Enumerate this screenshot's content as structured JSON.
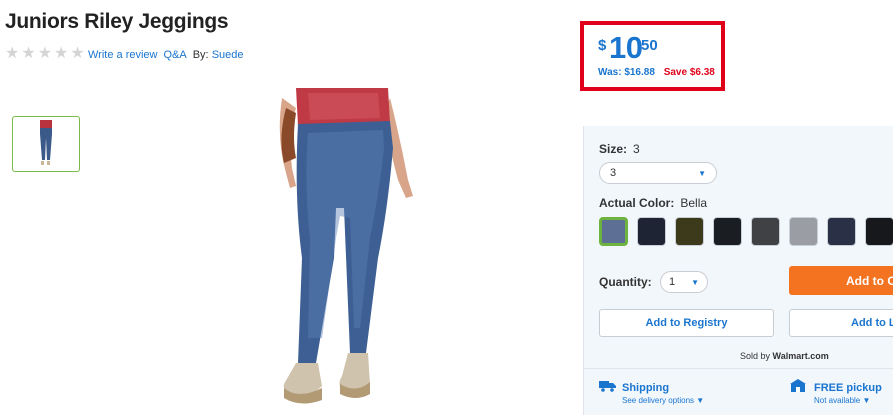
{
  "product": {
    "title": "Juniors Riley Jeggings",
    "rating_stars": 0,
    "write_review": "Write a review",
    "qa": "Q&A",
    "by_label": "By:",
    "brand": "Suede"
  },
  "price": {
    "dollar_sign": "$",
    "main": "10",
    "cents": "50",
    "was_label": "Was:",
    "was_price": "$16.88",
    "save": "Save $6.38"
  },
  "options": {
    "size_label": "Size:",
    "size_value": "3",
    "size_selected": "3",
    "color_label": "Actual Color:",
    "color_value": "Bella",
    "swatches": [
      {
        "name": "Bella",
        "color": "#5e6f96",
        "selected": true
      },
      {
        "name": "swatch-2",
        "color": "#1f2435",
        "selected": false
      },
      {
        "name": "swatch-3",
        "color": "#3d3a1c",
        "selected": false
      },
      {
        "name": "swatch-4",
        "color": "#1a1d22",
        "selected": false
      },
      {
        "name": "swatch-5",
        "color": "#3f4144",
        "selected": false
      },
      {
        "name": "swatch-6",
        "color": "#9a9ea4",
        "selected": false
      },
      {
        "name": "swatch-7",
        "color": "#2a3147",
        "selected": false
      },
      {
        "name": "swatch-8",
        "color": "#16181c",
        "selected": false
      }
    ],
    "quantity_label": "Quantity:",
    "quantity_value": "1"
  },
  "actions": {
    "add_to_cart": "Add to Cart",
    "add_to_registry": "Add to Registry",
    "add_to_list": "Add to List"
  },
  "seller": {
    "sold_by_label": "Sold by",
    "seller_name": "Walmart.com"
  },
  "fulfillment": {
    "shipping_title": "Shipping",
    "shipping_sub": "See delivery options",
    "pickup_title": "FREE pickup",
    "pickup_sub": "Not available"
  },
  "colors": {
    "accent_blue": "#1a75cf",
    "save_red": "#e0001a",
    "cart_orange": "#f47321",
    "highlight_red": "#e0001a"
  }
}
